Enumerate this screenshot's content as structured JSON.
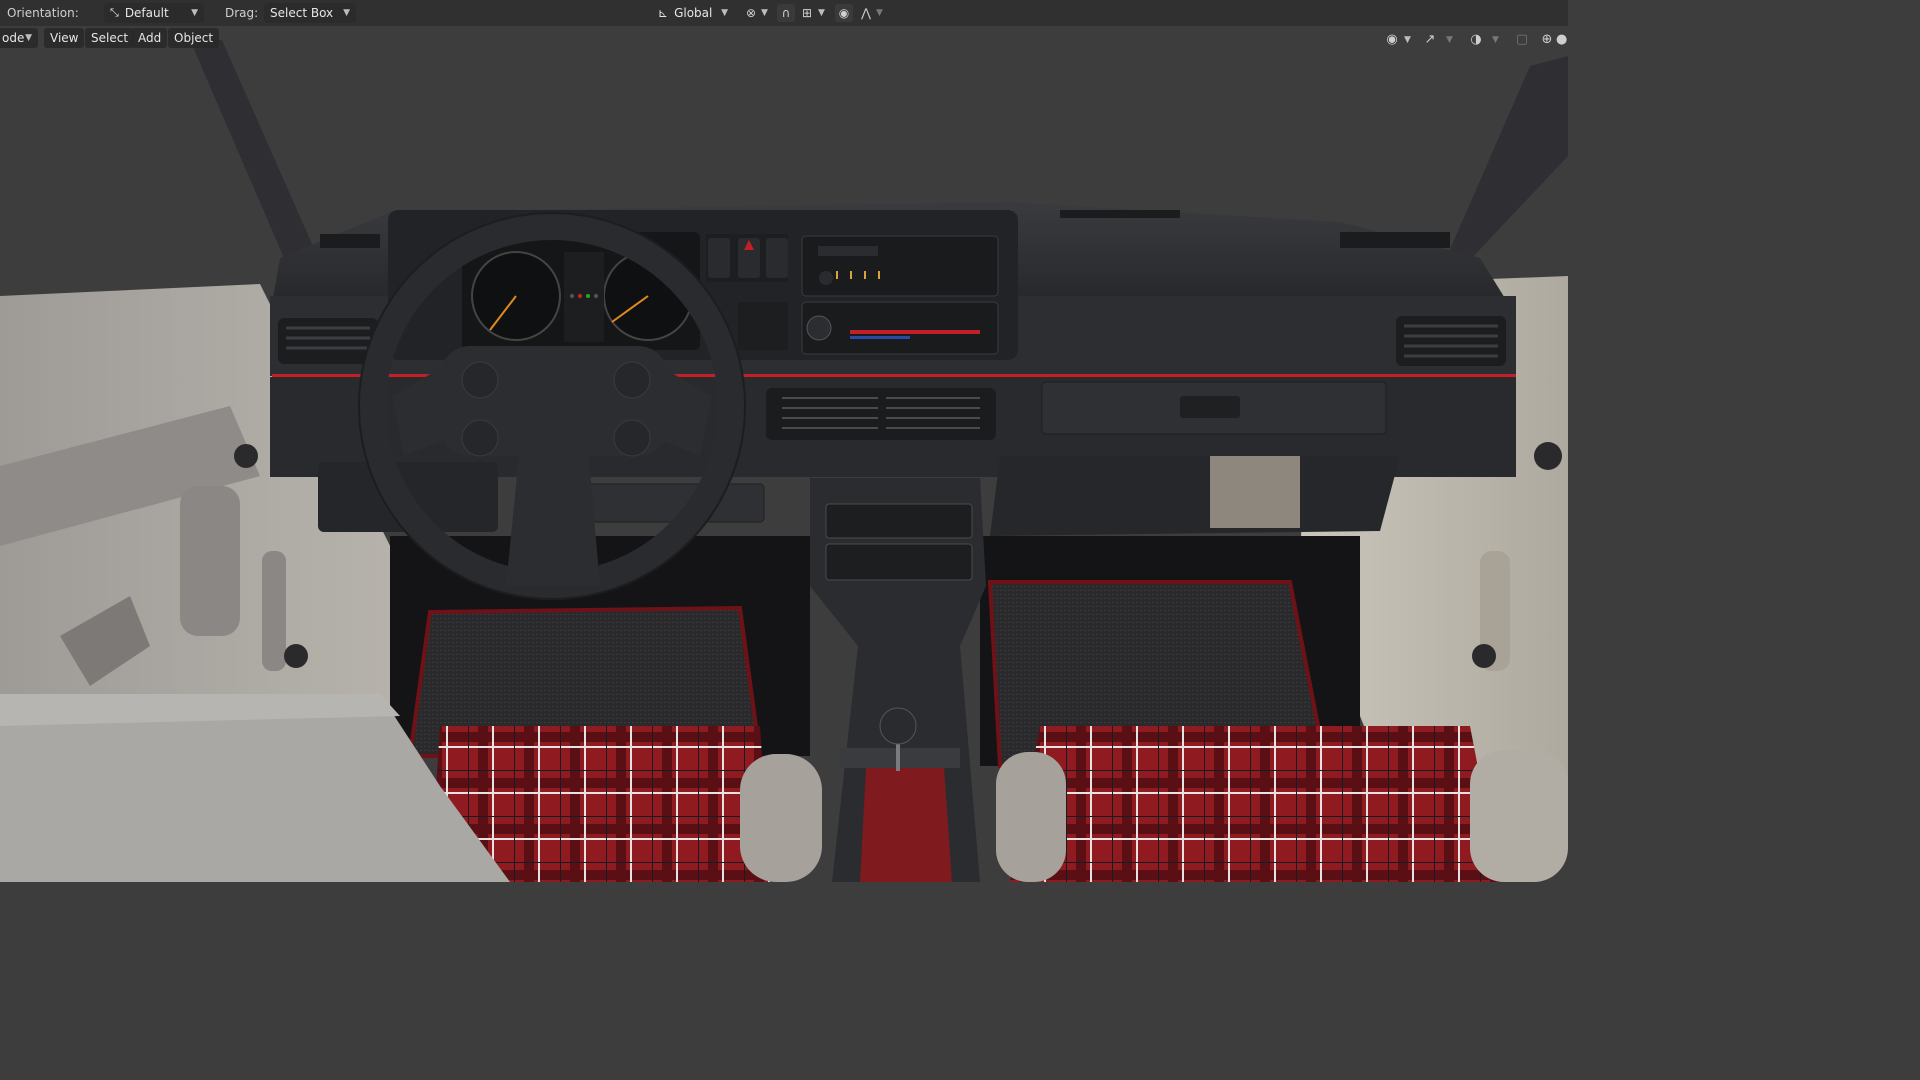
{
  "header": {
    "orientation_label": "Orientation:",
    "orientation_value": "Default",
    "drag_label": "Drag:",
    "drag_value": "Select Box",
    "transform_orientation": "Global"
  },
  "menubar": {
    "mode_label": "ode",
    "items": [
      "View",
      "Select",
      "Add",
      "Object"
    ]
  },
  "icons": {
    "orientation": "orientation-gizmo-icon",
    "transform": "transform-axes-icon",
    "pivot": "pivot-point-icon",
    "snap": "snap-magnet-icon",
    "snap_target": "snap-increment-icon",
    "proportional": "proportional-editing-icon",
    "falloff": "falloff-curve-icon",
    "visibility": "visibility-eye-icon",
    "gizmo": "gizmo-icon",
    "overlay": "overlay-icon",
    "xray": "xray-toggle-icon",
    "wireframe": "wireframe-shading-icon",
    "solid": "solid-shading-icon"
  },
  "colors": {
    "background": "#3d3d3d",
    "header": "#303030",
    "dashboard": "#2c2d30",
    "seat_red": "#8f1a1f",
    "accent_red": "#c21f26"
  }
}
